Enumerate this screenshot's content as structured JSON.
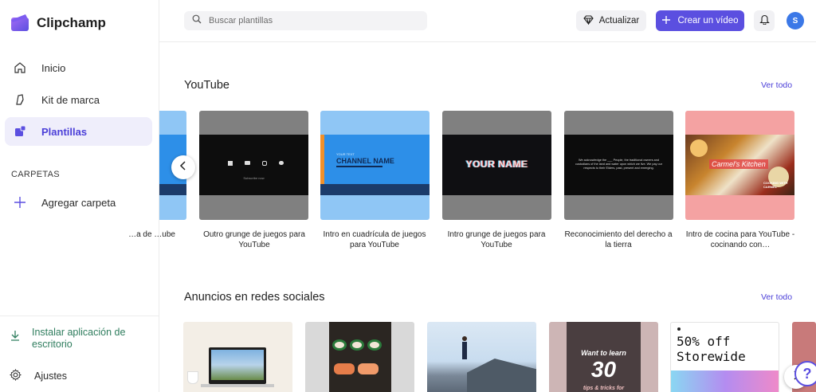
{
  "app": {
    "name": "Clipchamp"
  },
  "sidebar": {
    "items": [
      {
        "label": "Inicio",
        "icon": "home-icon"
      },
      {
        "label": "Kit de marca",
        "icon": "brand-kit-icon"
      },
      {
        "label": "Plantillas",
        "icon": "templates-icon"
      }
    ],
    "folders_label": "CARPETAS",
    "add_folder": "Agregar carpeta",
    "install_app": "Instalar aplicación de escritorio",
    "settings": "Ajustes"
  },
  "header": {
    "search_placeholder": "Buscar plantillas",
    "upgrade_label": "Actualizar",
    "create_label": "Crear un vídeo",
    "avatar_initial": "S"
  },
  "sections": [
    {
      "title": "YouTube",
      "see_all": "Ver todo",
      "cards": [
        {
          "label": "…a de …ube"
        },
        {
          "label": "Outro grunge de juegos para YouTube"
        },
        {
          "label": "Intro en cuadrícula de juegos para YouTube"
        },
        {
          "label": "Intro grunge de juegos para YouTube"
        },
        {
          "label": "Reconocimiento del derecho a la tierra"
        },
        {
          "label": "Intro de cocina para YouTube - cocinando con…"
        }
      ]
    },
    {
      "title": "Anuncios en redes sociales",
      "see_all": "Ver todo"
    }
  ],
  "thumbs": {
    "grid_title": "CHANNEL NAME",
    "grid_small": "YOUR TEXT",
    "your_name": "YOUR NAME",
    "ack_text": "We acknowledge the ___ People, the traditional owners and custodians of the land and water upon which we live. We pay our respects to their Elders, past, present and emerging.",
    "kitchen_title": "Carmel's Kitchen",
    "kitchen_sub": "COOKING WITH CARMEL",
    "outro_sub": "Subscribe now",
    "promo_line1": "50% off",
    "promo_line2": "Storewide",
    "want_text": "Want to learn",
    "big_number": "30",
    "tips_text": "tips & tricks for"
  },
  "colors": {
    "accent": "#5b4fe0",
    "install": "#2f7d5e",
    "help": "#5b4fe0"
  }
}
